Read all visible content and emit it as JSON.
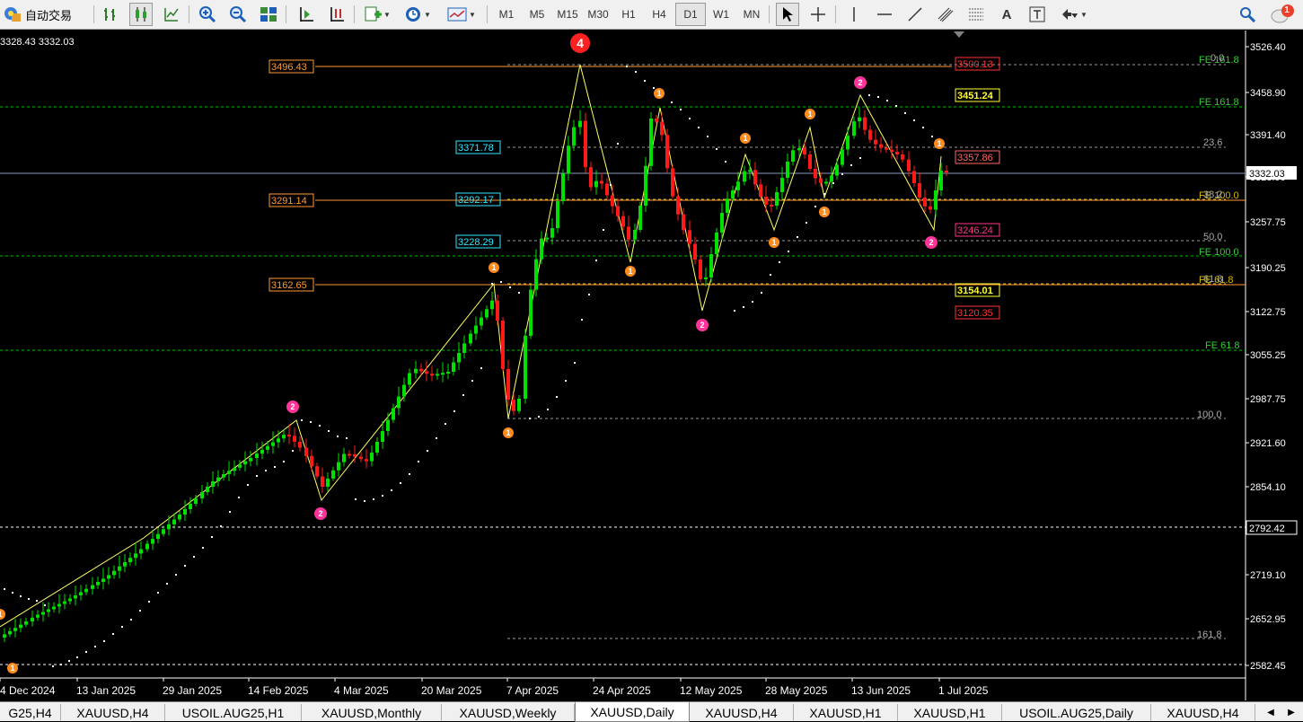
{
  "toolbar": {
    "autotrade_label": "自动交易",
    "timeframes": [
      "M1",
      "M5",
      "M15",
      "M30",
      "H1",
      "H4",
      "D1",
      "W1",
      "MN"
    ],
    "active_timeframe": "D1",
    "text_tool_label": "A",
    "notification_count": "1"
  },
  "chart": {
    "ohlc_text": "3328.43 3332.03",
    "price_axis": [
      "3526.40",
      "3458.90",
      "3391.40",
      "3323.90",
      "3257.75",
      "3190.25",
      "3122.75",
      "3055.25",
      "2987.75",
      "2921.60",
      "2854.10",
      "2719.10",
      "2652.95",
      "2582.45"
    ],
    "current_price": "3332.03",
    "marked_price": "2792.42",
    "date_axis": [
      "4 Dec 2024",
      "13 Jan 2025",
      "29 Jan 2025",
      "14 Feb 2025",
      "4 Mar 2025",
      "20 Mar 2025",
      "7 Apr 2025",
      "24 Apr 2025",
      "12 May 2025",
      "28 May 2025",
      "13 Jun 2025",
      "1 Jul 2025"
    ],
    "level_labels": [
      {
        "text": "3496.43",
        "color": "#ff9933"
      },
      {
        "text": "3371.78",
        "color": "#33e6ff"
      },
      {
        "text": "3291.14",
        "color": "#ff9933"
      },
      {
        "text": "3292.17",
        "color": "#33e6ff"
      },
      {
        "text": "3228.29",
        "color": "#33e6ff"
      },
      {
        "text": "3162.65",
        "color": "#ff9933"
      },
      {
        "text": "3500.13",
        "color": "#ff3333"
      },
      {
        "text": "3451.24",
        "color": "#ffff33"
      },
      {
        "text": "3357.86",
        "color": "#ff6666"
      },
      {
        "text": "3246.24",
        "color": "#ff3388"
      },
      {
        "text": "3154.01",
        "color": "#ffff33"
      },
      {
        "text": "3120.35",
        "color": "#ff3333"
      }
    ],
    "fib_labels": [
      "FE 161.8",
      "FE 161.8",
      "23.6",
      "FE 100.0",
      "38.2",
      "50.0",
      "FE 100.0",
      "61.8",
      "FE 61.8",
      "FE 61.8",
      "100.0",
      "161.8",
      "0.0"
    ],
    "wave_labels": [
      {
        "text": "4",
        "color": "#ff2020"
      },
      {
        "text": "2",
        "color": "#ff3399"
      },
      {
        "text": "1",
        "color": "#ff8c1a"
      }
    ]
  },
  "tabs": {
    "items": [
      "G25,H4",
      "XAUUSD,H4",
      "USOIL.AUG25,H1",
      "XAUUSD,Monthly",
      "XAUUSD,Weekly",
      "XAUUSD,Daily",
      "XAUUSD,H4",
      "XAUUSD,H1",
      "XAUUSD,H1",
      "USOIL.AUG25,Daily",
      "XAUUSD,H4"
    ],
    "active": "XAUUSD,Daily"
  }
}
